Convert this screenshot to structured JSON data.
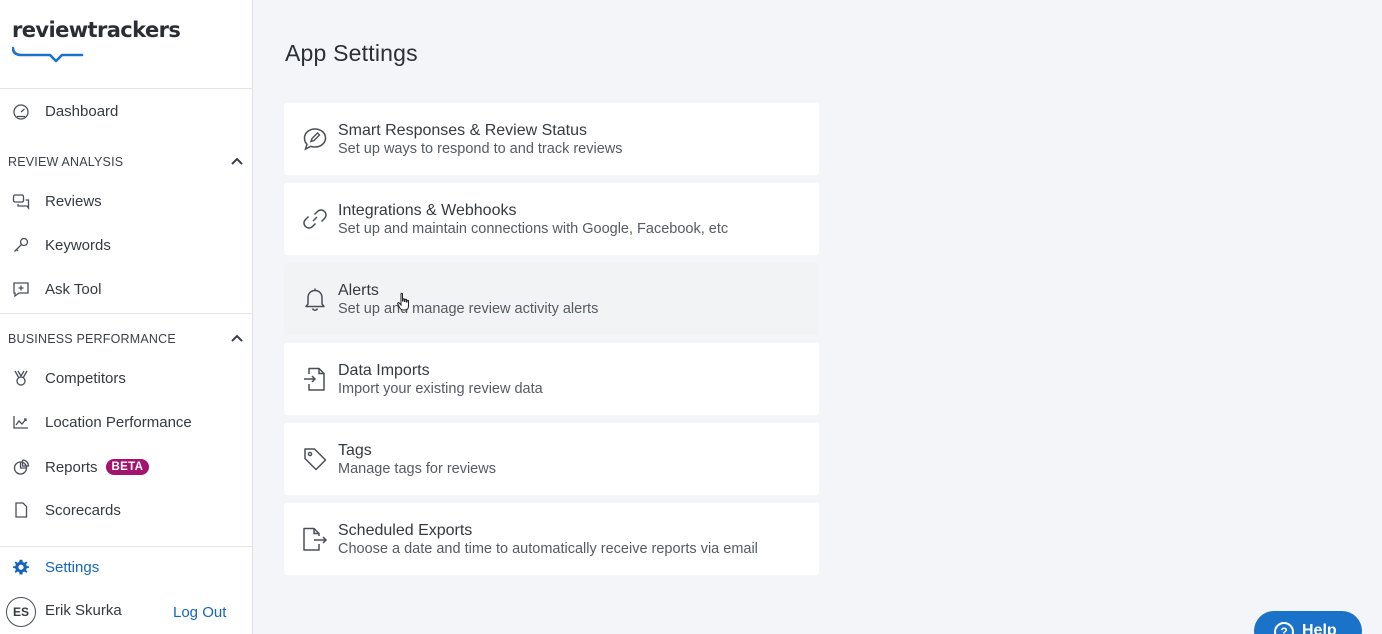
{
  "brand": {
    "name": "reviewtrackers",
    "accent": "#1565c0",
    "badge_color": "#a3146f"
  },
  "sidebar": {
    "dashboard": {
      "label": "Dashboard",
      "icon": "dashboard-gauge-icon"
    },
    "sections": [
      {
        "title": "REVIEW ANALYSIS",
        "items": [
          {
            "label": "Reviews",
            "icon": "chat-bubbles-icon"
          },
          {
            "label": "Keywords",
            "icon": "key-icon"
          },
          {
            "label": "Ask Tool",
            "icon": "chat-sparkle-icon"
          }
        ]
      },
      {
        "title": "BUSINESS PERFORMANCE",
        "items": [
          {
            "label": "Competitors",
            "icon": "medal-icon"
          },
          {
            "label": "Location Performance",
            "icon": "trend-chart-icon"
          },
          {
            "label": "Reports",
            "icon": "pie-chart-icon",
            "badge": "BETA"
          },
          {
            "label": "Scorecards",
            "icon": "document-icon"
          }
        ]
      }
    ],
    "settings": {
      "label": "Settings",
      "icon": "gear-icon"
    },
    "user": {
      "initials": "ES",
      "name": "Erik Skurka",
      "logout_label": "Log Out"
    }
  },
  "main": {
    "title": "App Settings",
    "cards": [
      {
        "title": "Smart Responses & Review Status",
        "desc": "Set up ways to respond to and track reviews",
        "icon": "chat-pencil-icon"
      },
      {
        "title": "Integrations & Webhooks",
        "desc": "Set up and maintain connections with Google, Facebook, etc",
        "icon": "link-icon"
      },
      {
        "title": "Alerts",
        "desc": "Set up and manage review activity alerts",
        "icon": "bell-icon"
      },
      {
        "title": "Data Imports",
        "desc": "Import your existing review data",
        "icon": "file-import-icon"
      },
      {
        "title": "Tags",
        "desc": "Manage tags for reviews",
        "icon": "tag-icon"
      },
      {
        "title": "Scheduled Exports",
        "desc": "Choose a date and time to automatically receive reports via email",
        "icon": "file-export-icon"
      }
    ]
  },
  "help": {
    "label": "Help"
  }
}
